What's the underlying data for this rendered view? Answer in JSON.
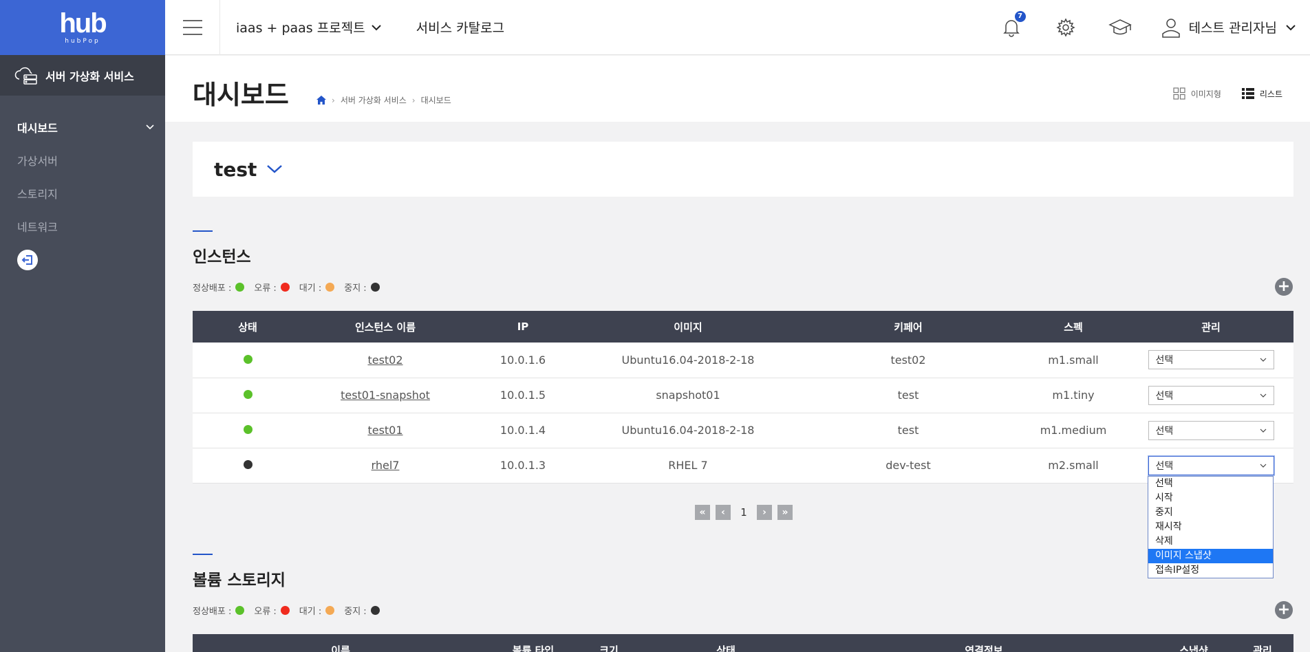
{
  "sidebar": {
    "logo_mark": "hub",
    "logo_sub": "hubPop",
    "service_title": "서버 가상화 서비스",
    "items": [
      {
        "label": "대시보드"
      },
      {
        "label": "가상서버"
      },
      {
        "label": "스토리지"
      },
      {
        "label": "네트워크"
      }
    ]
  },
  "header": {
    "project": "iaas + paas 프로젝트",
    "catalog": "서비스 카탈로그",
    "notification_count": "7",
    "user_name": "테스트 관리자님"
  },
  "page": {
    "title": "대시보드",
    "breadcrumb": [
      "서버 가상화 서비스",
      "대시보드"
    ],
    "view_image": "이미지형",
    "view_list": "리스트"
  },
  "project_selector": {
    "name": "test"
  },
  "legend": [
    {
      "label": "정상배포 :",
      "color": "#5bc12a"
    },
    {
      "label": "오류 :",
      "color": "#f02b1e"
    },
    {
      "label": "대기 :",
      "color": "#f4a954"
    },
    {
      "label": "중지 :",
      "color": "#333333"
    }
  ],
  "instances": {
    "title": "인스턴스",
    "columns": [
      "상태",
      "인스턴스 이름",
      "IP",
      "이미지",
      "키페어",
      "스펙",
      "관리"
    ],
    "rows": [
      {
        "status_color": "#5bc12a",
        "name": "test02",
        "ip": "10.0.1.6",
        "image": "Ubuntu16.04-2018-2-18",
        "keypair": "test02",
        "spec": "m1.small",
        "manage": "선택"
      },
      {
        "status_color": "#5bc12a",
        "name": "test01-snapshot",
        "ip": "10.0.1.5",
        "image": "snapshot01",
        "keypair": "test",
        "spec": "m1.tiny",
        "manage": "선택"
      },
      {
        "status_color": "#5bc12a",
        "name": "test01",
        "ip": "10.0.1.4",
        "image": "Ubuntu16.04-2018-2-18",
        "keypair": "test",
        "spec": "m1.medium",
        "manage": "선택"
      },
      {
        "status_color": "#333333",
        "name": "rhel7",
        "ip": "10.0.1.3",
        "image": "RHEL 7",
        "keypair": "dev-test",
        "spec": "m2.small",
        "manage": "선택"
      }
    ],
    "dropdown_options": [
      "선택",
      "시작",
      "중지",
      "재시작",
      "삭제",
      "이미지 스냅샷",
      "접속IP설정"
    ],
    "dropdown_highlighted": "이미지 스냅샷",
    "page": "1"
  },
  "volumes": {
    "title": "볼륨 스토리지",
    "columns": [
      "이름",
      "볼륨 타입",
      "크기",
      "상태",
      "연결정보",
      "스냅샷",
      "관리"
    ]
  }
}
